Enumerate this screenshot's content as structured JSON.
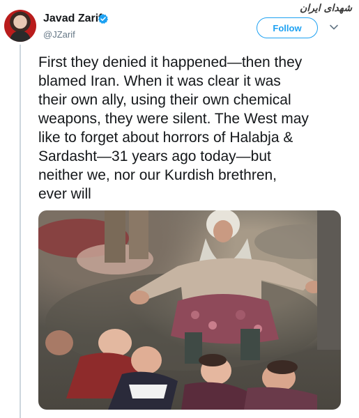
{
  "tweet": {
    "author_name": "Javad Zarif",
    "author_handle": "@JZarif",
    "follow_label": "Follow",
    "text": "First they denied it happened—then they\nblamed Iran. When it was clear it was\ntheir own ally, using their own chemical\nweapons, they were silent. The West may\nlike to forget about horrors of Halabja &\nSardasht—31 years ago today—but\nneither we, nor our Kurdish brethren,\never will"
  },
  "watermark": {
    "text": "شهدای ایران"
  },
  "colors": {
    "accent": "#1da1f2",
    "text": "#14171a",
    "secondary": "#657786"
  },
  "icons": {
    "verified": "verified-badge-icon",
    "menu": "chevron-down-icon"
  }
}
